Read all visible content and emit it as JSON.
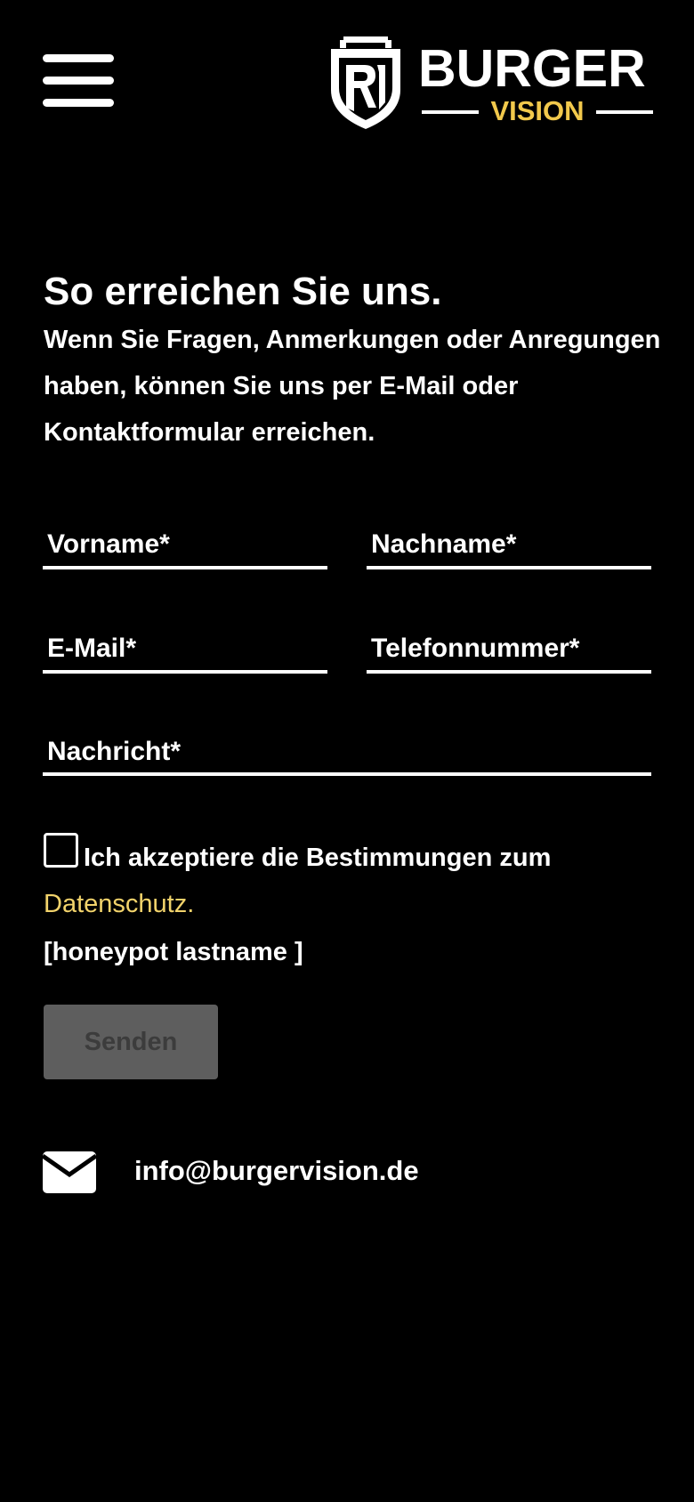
{
  "header": {
    "menu_icon": "hamburger-menu-icon",
    "logo": {
      "main": "BURGER",
      "sub": "VISION",
      "accent_color": "#f2c94c"
    }
  },
  "intro": {
    "heading": "So erreichen Sie uns.",
    "text": "Wenn Sie Fragen, Anmerkungen oder Anregungen haben, können Sie uns per E-Mail oder Kontaktformular erreichen."
  },
  "form": {
    "first_name_placeholder": "Vorname*",
    "last_name_placeholder": "Nachname*",
    "email_placeholder": "E-Mail*",
    "phone_placeholder": "Telefonnummer*",
    "message_placeholder": "Nachricht*",
    "consent_text": "Ich akzeptiere die Bestimmungen zum",
    "privacy_link": "Datenschutz.",
    "privacy_link_color": "#f2d36b",
    "honeypot": "[honeypot lastname ]",
    "submit_label": "Senden",
    "submit_enabled": false
  },
  "contact": {
    "icon": "envelope-icon",
    "email": "info@burgervision.de"
  }
}
